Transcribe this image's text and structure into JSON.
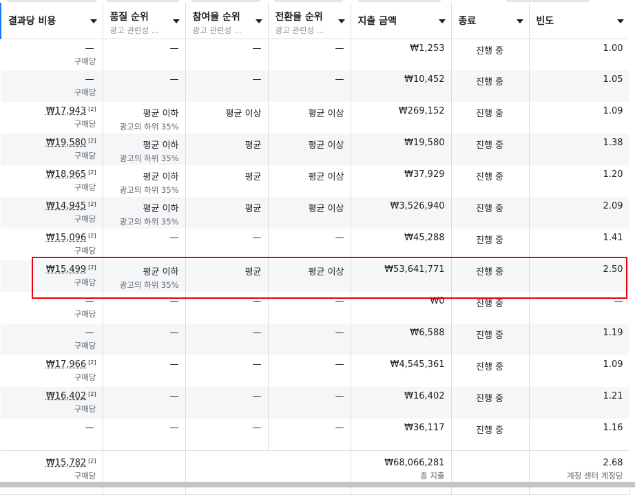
{
  "headers": [
    {
      "label": "결과당 비용",
      "sub": ""
    },
    {
      "label": "품질 순위",
      "sub": "광고 관련성 ..."
    },
    {
      "label": "참여율 순위",
      "sub": "광고 관련성 ..."
    },
    {
      "label": "전환율 순위",
      "sub": "광고 관련성 ..."
    },
    {
      "label": "지출 금액",
      "sub": ""
    },
    {
      "label": "종료",
      "sub": ""
    },
    {
      "label": "빈도",
      "sub": ""
    }
  ],
  "rows": [
    {
      "cost": "—",
      "note": "",
      "cost_sub": "구매당",
      "quality": "—",
      "quality_sub": "",
      "engagement": "—",
      "conversion": "—",
      "spend": "₩1,253",
      "status": "진행 중",
      "freq": "1.00"
    },
    {
      "cost": "—",
      "note": "",
      "cost_sub": "구매당",
      "quality": "—",
      "quality_sub": "",
      "engagement": "—",
      "conversion": "—",
      "spend": "₩10,452",
      "status": "진행 중",
      "freq": "1.05"
    },
    {
      "cost": "₩17,943",
      "note": "[2]",
      "cost_sub": "구매당",
      "quality": "평균 이하",
      "quality_sub": "광고의 하위 35%",
      "engagement": "평균 이상",
      "conversion": "평균 이상",
      "spend": "₩269,152",
      "status": "진행 중",
      "freq": "1.09"
    },
    {
      "cost": "₩19,580",
      "note": "[2]",
      "cost_sub": "구매당",
      "quality": "평균 이하",
      "quality_sub": "광고의 하위 35%",
      "engagement": "평균",
      "conversion": "평균 이상",
      "spend": "₩19,580",
      "status": "진행 중",
      "freq": "1.38"
    },
    {
      "cost": "₩18,965",
      "note": "[2]",
      "cost_sub": "구매당",
      "quality": "평균 이하",
      "quality_sub": "광고의 하위 35%",
      "engagement": "평균",
      "conversion": "평균 이상",
      "spend": "₩37,929",
      "status": "진행 중",
      "freq": "1.20"
    },
    {
      "cost": "₩14,945",
      "note": "[2]",
      "cost_sub": "구매당",
      "quality": "평균 이하",
      "quality_sub": "광고의 하위 35%",
      "engagement": "평균",
      "conversion": "평균 이상",
      "spend": "₩3,526,940",
      "status": "진행 중",
      "freq": "2.09"
    },
    {
      "cost": "₩15,096",
      "note": "[2]",
      "cost_sub": "구매당",
      "quality": "—",
      "quality_sub": "",
      "engagement": "—",
      "conversion": "—",
      "spend": "₩45,288",
      "status": "진행 중",
      "freq": "1.41"
    },
    {
      "cost": "₩15,499",
      "note": "[2]",
      "cost_sub": "구매당",
      "quality": "평균 이하",
      "quality_sub": "광고의 하위 35%",
      "engagement": "평균",
      "conversion": "평균 이상",
      "spend": "₩53,641,771",
      "status": "진행 중",
      "freq": "2.50"
    },
    {
      "cost": "—",
      "note": "",
      "cost_sub": "구매당",
      "quality": "—",
      "quality_sub": "",
      "engagement": "—",
      "conversion": "—",
      "spend": "₩0",
      "status": "진행 중",
      "freq": "—"
    },
    {
      "cost": "—",
      "note": "",
      "cost_sub": "구매당",
      "quality": "—",
      "quality_sub": "",
      "engagement": "—",
      "conversion": "—",
      "spend": "₩6,588",
      "status": "진행 중",
      "freq": "1.19"
    },
    {
      "cost": "₩17,966",
      "note": "[2]",
      "cost_sub": "구매당",
      "quality": "—",
      "quality_sub": "",
      "engagement": "—",
      "conversion": "—",
      "spend": "₩4,545,361",
      "status": "진행 중",
      "freq": "1.09"
    },
    {
      "cost": "₩16,402",
      "note": "[2]",
      "cost_sub": "구매당",
      "quality": "—",
      "quality_sub": "",
      "engagement": "—",
      "conversion": "—",
      "spend": "₩16,402",
      "status": "진행 중",
      "freq": "1.21"
    },
    {
      "cost": "—",
      "note": "",
      "cost_sub": "",
      "quality": "—",
      "quality_sub": "",
      "engagement": "—",
      "conversion": "—",
      "spend": "₩36,117",
      "status": "진행 중",
      "freq": "1.16"
    }
  ],
  "total": {
    "cost": "₩15,782",
    "note": "[2]",
    "cost_sub": "구매당",
    "spend": "₩68,066,281",
    "spend_sub": "총 지출",
    "freq": "2.68",
    "freq_sub": "계정 센터 계정당"
  },
  "colors": {
    "accent": "#1877f2",
    "highlight": "#e8000b",
    "alt_row": "#f5f6f7"
  }
}
